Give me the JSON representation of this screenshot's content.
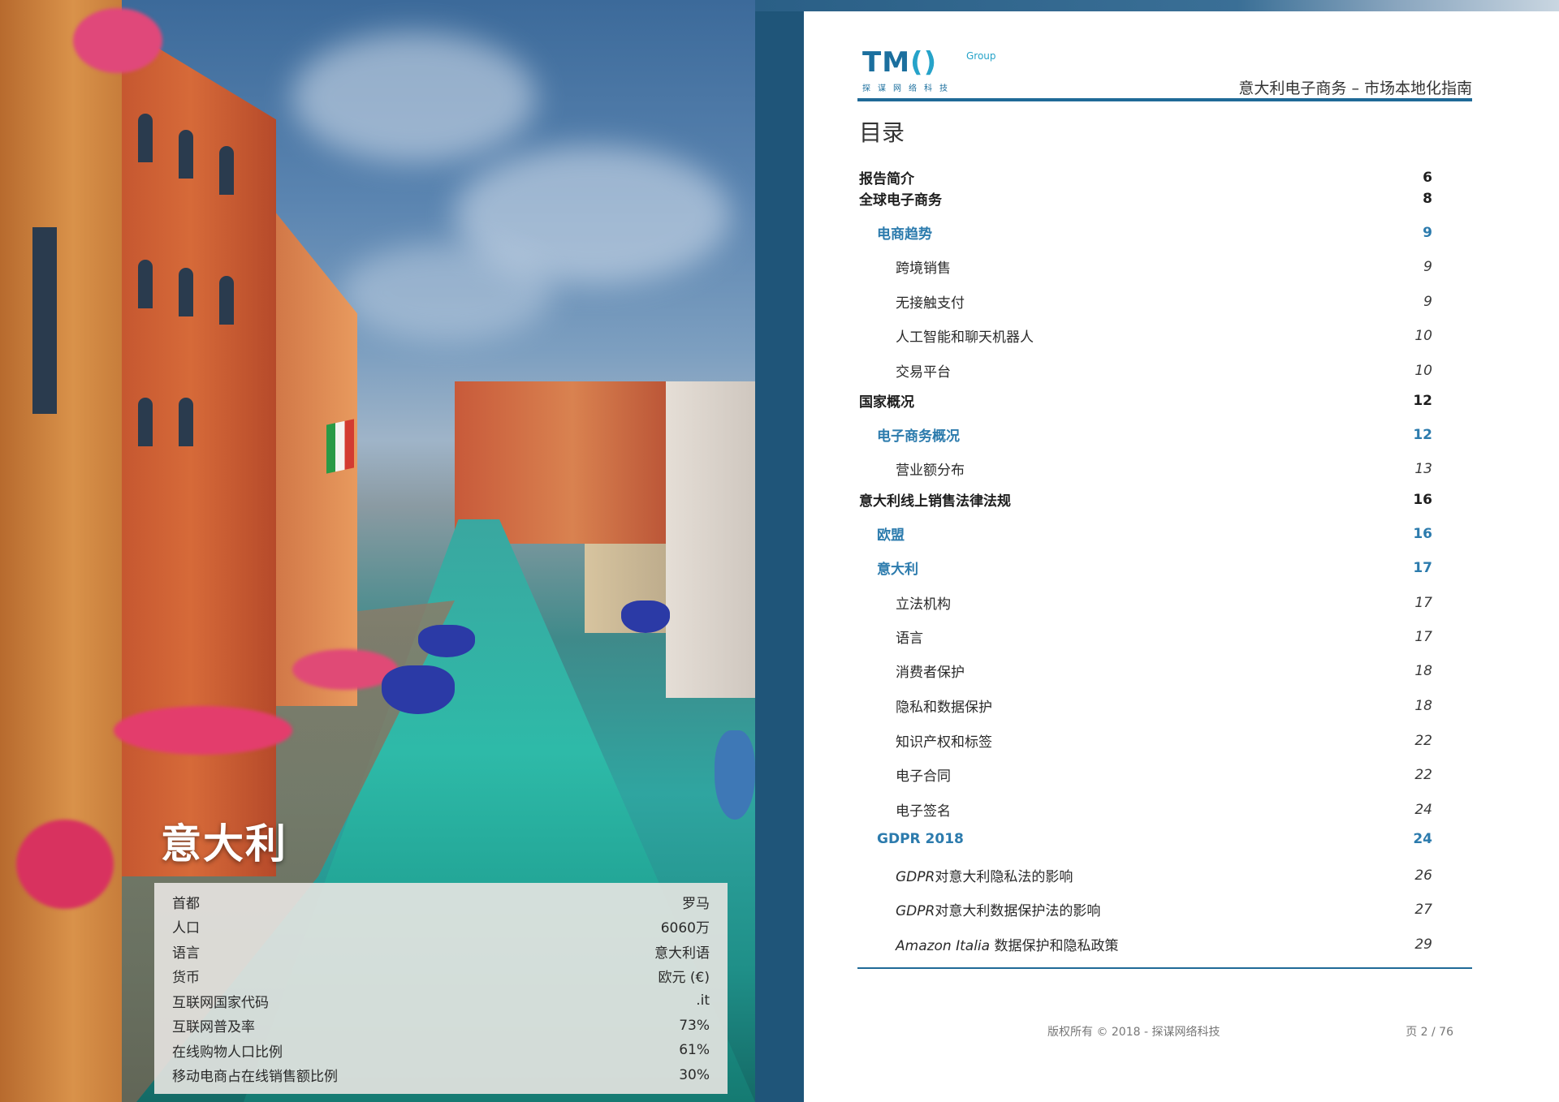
{
  "cover": {
    "country_title": "意大利",
    "facts": [
      {
        "label": "首都",
        "value": "罗马"
      },
      {
        "label": "人口",
        "value": "6060万"
      },
      {
        "label": "语言",
        "value": "意大利语"
      },
      {
        "label": "货币",
        "value": "欧元 (€)"
      },
      {
        "label": "互联网国家代码",
        "value": ".it"
      },
      {
        "label": "互联网普及率",
        "value": "73%"
      },
      {
        "label": "在线购物人口比例",
        "value": "61%"
      },
      {
        "label": "移动电商占在线销售额比例",
        "value": "30%"
      }
    ]
  },
  "header": {
    "logo_main": "TM",
    "logo_bracket": "()",
    "logo_group": "Group",
    "logo_sub": "探谋网络科技",
    "doc_title": "意大利电子商务 – 市场本地化指南"
  },
  "toc": {
    "heading": "目录",
    "entries": [
      {
        "title": "报告简介",
        "page": "6"
      },
      {
        "title": "全球电子商务",
        "page": "8"
      },
      {
        "title": "电商趋势",
        "page": "9"
      },
      {
        "title": "跨境销售",
        "page": "9"
      },
      {
        "title": "无接触支付",
        "page": "9"
      },
      {
        "title": "人工智能和聊天机器人",
        "page": "10"
      },
      {
        "title": "交易平台",
        "page": "10"
      },
      {
        "title": "国家概况",
        "page": "12"
      },
      {
        "title": "电子商务概况",
        "page": "12"
      },
      {
        "title": "营业额分布",
        "page": "13"
      },
      {
        "title": "意大利线上销售法律法规",
        "page": "16"
      },
      {
        "title": "欧盟",
        "page": "16"
      },
      {
        "title": "意大利",
        "page": "17"
      },
      {
        "title": "立法机构",
        "page": "17"
      },
      {
        "title": "语言",
        "page": "17"
      },
      {
        "title": "消费者保护",
        "page": "18"
      },
      {
        "title": "隐私和数据保护",
        "page": "18"
      },
      {
        "title": "知识产权和标签",
        "page": "22"
      },
      {
        "title": "电子合同",
        "page": "22"
      },
      {
        "title": "电子签名",
        "page": "24"
      },
      {
        "title": "GDPR 2018",
        "page": "24"
      },
      {
        "title_lead": "GDPR",
        "title": "对意大利隐私法的影响",
        "page": "26"
      },
      {
        "title_lead": "GDPR",
        "title": "对意大利数据保护法的影响",
        "page": "27"
      },
      {
        "title_lead": "Amazon Italia",
        "title": " 数据保护和隐私政策",
        "page": "29"
      }
    ]
  },
  "footer": {
    "copyright": "版权所有 © 2018 - 探谋网络科技",
    "page_indicator": "页 2 / 76"
  }
}
